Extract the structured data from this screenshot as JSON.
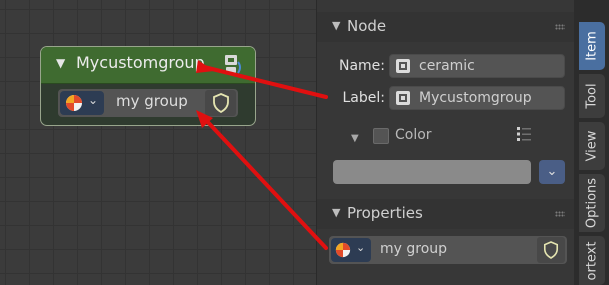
{
  "node": {
    "title": "Mycustomgroup",
    "group_name": "my group"
  },
  "sidebar": {
    "node_panel": {
      "title": "Node",
      "name_label": "Name:",
      "name_value": "ceramic",
      "label_label": "Label:",
      "label_value": "Mycustomgroup"
    },
    "color_panel": {
      "title": "Color",
      "enabled": false
    },
    "properties_panel": {
      "title": "Properties",
      "group_name": "my group"
    }
  },
  "tabs": [
    {
      "label": "Item",
      "active": true
    },
    {
      "label": "Tool",
      "active": false
    },
    {
      "label": "View",
      "active": false
    },
    {
      "label": "Options",
      "active": false
    },
    {
      "label": "ortext",
      "active": false
    }
  ],
  "colors": {
    "node_header": "#3f6b30",
    "active_tab": "#4a6fa0",
    "annotation_arrow": "#e01010"
  }
}
